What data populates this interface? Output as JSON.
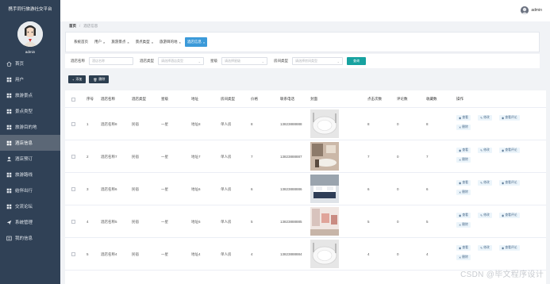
{
  "app": {
    "title": "携手同行旅游社交平台",
    "user": "admin"
  },
  "header": {
    "user": "admin"
  },
  "sidebar": {
    "items": [
      {
        "label": "首页",
        "icon": "home-icon"
      },
      {
        "label": "用户",
        "icon": "grid-icon"
      },
      {
        "label": "旅游景点",
        "icon": "grid-icon"
      },
      {
        "label": "景点类型",
        "icon": "grid-icon"
      },
      {
        "label": "旅游目的地",
        "icon": "grid-icon"
      },
      {
        "label": "酒店信息",
        "icon": "grid-icon",
        "active": true
      },
      {
        "label": "酒店预订",
        "icon": "user-icon"
      },
      {
        "label": "旅游路线",
        "icon": "grid-icon"
      },
      {
        "label": "结伴出行",
        "icon": "grid-icon"
      },
      {
        "label": "交流论坛",
        "icon": "grid-icon"
      },
      {
        "label": "系统管理",
        "icon": "send-icon"
      },
      {
        "label": "我的信息",
        "icon": "profile-icon"
      }
    ]
  },
  "breadcrumb": {
    "home": "首页",
    "current": "酒店信息"
  },
  "tabs": [
    {
      "label": "系统首页",
      "closable": false
    },
    {
      "label": "用户",
      "closable": true
    },
    {
      "label": "旅游景点",
      "closable": true
    },
    {
      "label": "景点类型",
      "closable": true
    },
    {
      "label": "旅游目的地",
      "closable": true
    },
    {
      "label": "酒店信息",
      "closable": true,
      "active": true
    }
  ],
  "search": {
    "hotel_name_label": "酒店名称",
    "hotel_name_placeholder": "酒店名称",
    "hotel_type_label": "酒店类型",
    "hotel_type_placeholder": "请选择酒店类型",
    "star_label": "星级",
    "star_placeholder": "请选择星级",
    "room_type_label": "房间类型",
    "room_type_placeholder": "请选择房间类型",
    "search_button": "查询"
  },
  "actions": {
    "add": "添加",
    "delete": "删除"
  },
  "table": {
    "columns": [
      "序号",
      "酒店名称",
      "酒店类型",
      "星级",
      "地址",
      "房间类型",
      "价格",
      "联系电话",
      "封面",
      "点击次数",
      "评论数",
      "收藏数",
      "操作"
    ],
    "rows": [
      {
        "index": "1",
        "name": "酒店名称8",
        "type": "民宿",
        "star": "一星",
        "address": "地址8",
        "room": "单人房",
        "price": "8",
        "phone": "13823888888",
        "clicks": "8",
        "comments": "0",
        "favorites": "8",
        "cover": "plate"
      },
      {
        "index": "2",
        "name": "酒店名称7",
        "type": "民宿",
        "star": "一星",
        "address": "地址7",
        "room": "单人房",
        "price": "7",
        "phone": "13823888887",
        "clicks": "7",
        "comments": "0",
        "favorites": "7",
        "cover": "room"
      },
      {
        "index": "3",
        "name": "酒店名称6",
        "type": "民宿",
        "star": "一星",
        "address": "地址6",
        "room": "单人房",
        "price": "6",
        "phone": "13823888886",
        "clicks": "6",
        "comments": "0",
        "favorites": "6",
        "cover": "bed"
      },
      {
        "index": "4",
        "name": "酒店名称5",
        "type": "民宿",
        "star": "一星",
        "address": "地址5",
        "room": "单人房",
        "price": "5",
        "phone": "13823888885",
        "clicks": "5",
        "comments": "0",
        "favorites": "5",
        "cover": "chairs"
      },
      {
        "index": "5",
        "name": "酒店名称4",
        "type": "民宿",
        "star": "一星",
        "address": "地址4",
        "room": "单人房",
        "price": "4",
        "phone": "13823888884",
        "clicks": "4",
        "comments": "0",
        "favorites": "4",
        "cover": "plate"
      }
    ],
    "ops": {
      "view": "查看",
      "edit": "修改",
      "review": "查看评论",
      "delete": "删除"
    }
  },
  "watermark": "CSDN @毕文程序设计",
  "colors": {
    "sidebar": "#304156",
    "active_tab": "#3b9ad9",
    "search_btn": "#17a2a0",
    "action_btn": "#2c3e50"
  }
}
